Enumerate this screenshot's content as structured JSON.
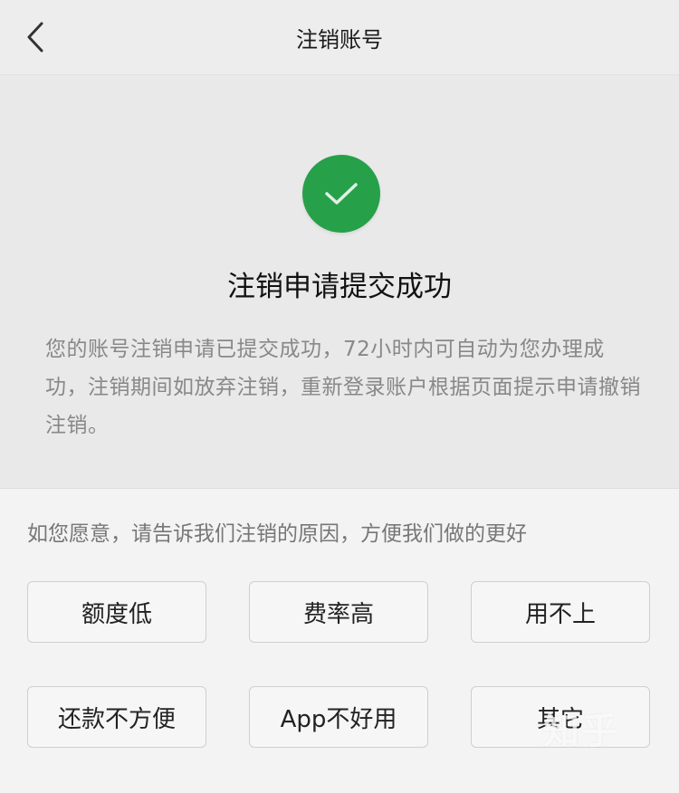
{
  "nav": {
    "title": "注销账号",
    "back_icon": "chevron-left-icon"
  },
  "result": {
    "icon": "checkmark-icon",
    "icon_color": "#27a04a",
    "title": "注销申请提交成功",
    "description": "您的账号注销申请已提交成功，72小时内可自动为您办理成功，注销期间如放弃注销，重新登录账户根据页面提示申请撤销注销。"
  },
  "reasons": {
    "prompt": "如您愿意，请告诉我们注销的原因，方便我们做的更好",
    "options": [
      "额度低",
      "费率高",
      "用不上",
      "还款不方便",
      "App不好用",
      "其它"
    ]
  },
  "watermark": "知乎"
}
